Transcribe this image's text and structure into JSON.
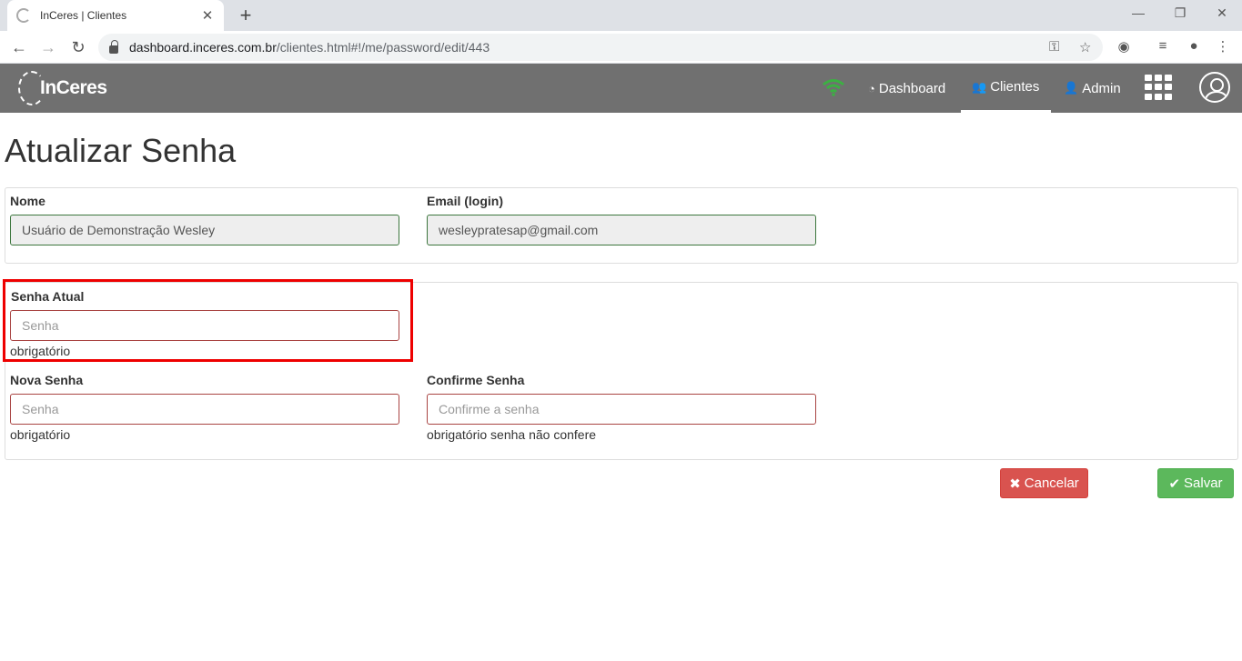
{
  "browser": {
    "tab_title": "InCeres | Clientes",
    "tab_close": "✕",
    "new_tab": "+",
    "window_controls": {
      "minimize": "—",
      "restore": "❐",
      "close": "✕"
    },
    "url_host": "dashboard.inceres.com.br",
    "url_path": "/clientes.html#!/me/password/edit/443",
    "icons": [
      "back-icon",
      "forward-icon",
      "reload-icon",
      "lock-icon",
      "key-icon",
      "star-icon",
      "extension-icon",
      "media-icon",
      "account-icon",
      "menu-icon"
    ]
  },
  "navbar": {
    "logo_text": "InCeres",
    "wifi_color": "#3cb043",
    "links": [
      {
        "label": "Dashboard",
        "icon": "dashboard-icon"
      },
      {
        "label": "Clientes",
        "icon": "users-icon",
        "active": true
      },
      {
        "label": "Admin",
        "icon": "user-plus-icon"
      }
    ],
    "background": "#707070"
  },
  "page": {
    "title": "Atualizar Senha"
  },
  "profile_panel": {
    "name_label": "Nome",
    "name_value": "Usuário de Demonstração Wesley",
    "email_label": "Email (login)",
    "email_value": "wesleypratesap@gmail.com"
  },
  "password_panel": {
    "current_label": "Senha Atual",
    "current_placeholder": "Senha",
    "current_help": "obrigatório",
    "new_label": "Nova Senha",
    "new_placeholder": "Senha",
    "new_help": "obrigatório",
    "confirm_label": "Confirme Senha",
    "confirm_placeholder": "Confirme a senha",
    "confirm_help": "obrigatório senha não confere"
  },
  "actions": {
    "cancel_icon": "✖",
    "cancel_label": "Cancelar",
    "save_icon": "✔",
    "save_label": "Salvar",
    "cancel_color": "#d9534f",
    "save_color": "#5cb85c"
  }
}
